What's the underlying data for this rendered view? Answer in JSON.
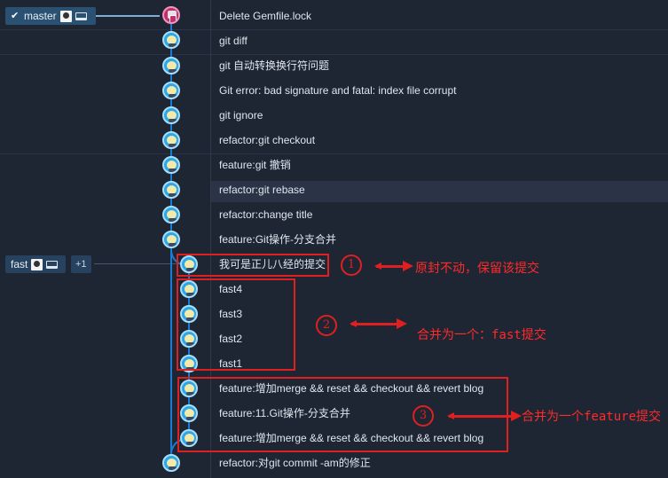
{
  "branches": {
    "master": {
      "label": "master",
      "check_icon": "check-icon",
      "avatar_icon": "avatar-icon",
      "local_icon": "laptop-icon"
    },
    "fast": {
      "label": "fast",
      "avatar_icon": "avatar-icon",
      "local_icon": "laptop-icon",
      "extra": "+1"
    }
  },
  "commits": [
    {
      "message": "Delete Gemfile.lock"
    },
    {
      "message": "git diff"
    },
    {
      "message": "git 自动转换换行符问题"
    },
    {
      "message": "Git error: bad signature and fatal: index file corrupt"
    },
    {
      "message": "git ignore"
    },
    {
      "message": "refactor:git checkout"
    },
    {
      "message": "feature:git 撤销"
    },
    {
      "message": "refactor:git rebase"
    },
    {
      "message": "refactor:change title"
    },
    {
      "message": "feature:Git操作-分支合并"
    },
    {
      "message": "我可是正儿八经的提交"
    },
    {
      "message": "fast4"
    },
    {
      "message": "fast3"
    },
    {
      "message": "fast2"
    },
    {
      "message": "fast1"
    },
    {
      "message": "feature:增加merge && reset && checkout && revert blog"
    },
    {
      "message": "feature:11.Git操作-分支合并"
    },
    {
      "message": "feature:增加merge && reset && checkout && revert blog"
    },
    {
      "message": "refactor:对git commit -am的修正"
    }
  ],
  "annotations": [
    {
      "number": "1",
      "note": "原封不动，保留该提交"
    },
    {
      "number": "2",
      "note": "合并为一个：fast提交"
    },
    {
      "number": "3",
      "note": "合并为一个feature提交"
    }
  ],
  "colors": {
    "background": "#1e2634",
    "lane": "#1b7bd2",
    "annotation": "#e02020",
    "master_badge": "#2a5172"
  }
}
